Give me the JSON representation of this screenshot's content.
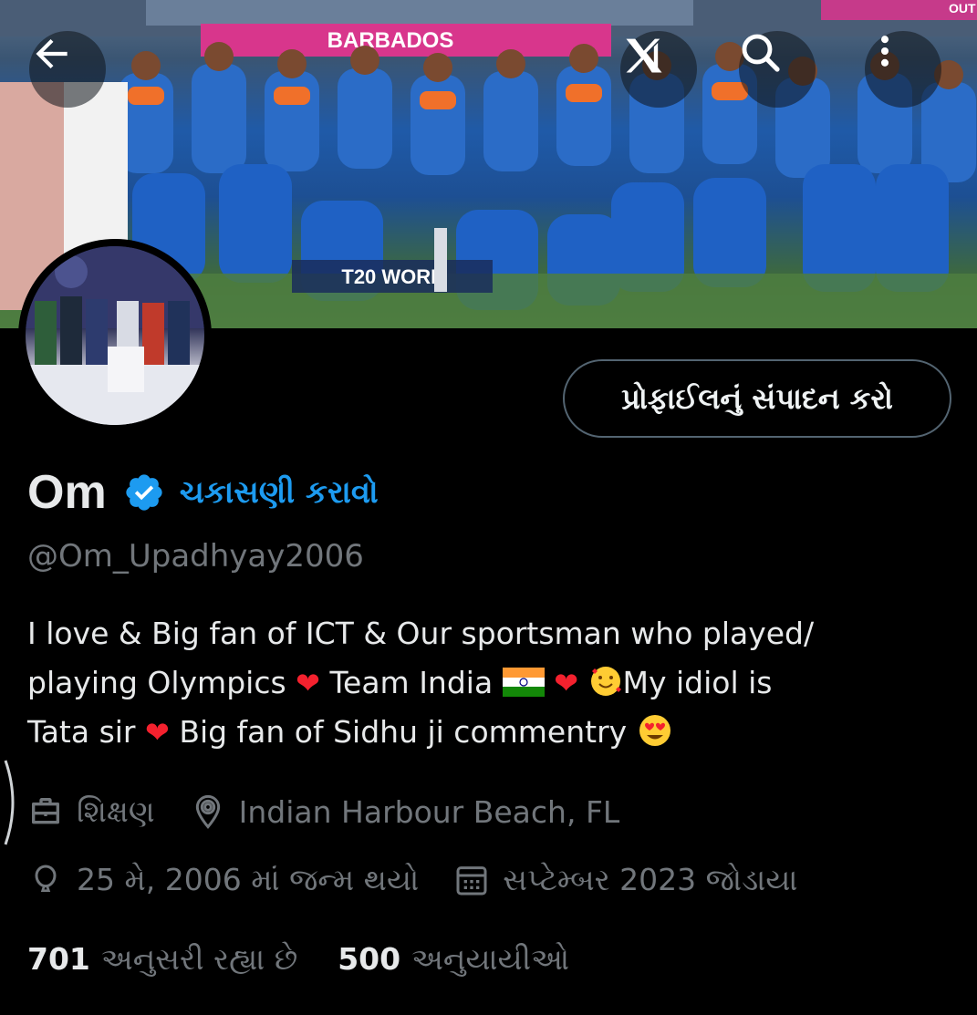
{
  "header": {
    "back_icon": "arrow-left-icon",
    "grok_icon": "grok-icon",
    "search_icon": "search-icon",
    "more_icon": "more-vertical-icon"
  },
  "banner": {
    "signs": [
      "BARBADOS",
      "T20 WORL",
      "OUT"
    ]
  },
  "profile": {
    "edit_button": "પ્રોફાઈલનું સંપાદન કરો",
    "name": "Om",
    "verify_link": "ચકાસણી કરાવો",
    "handle": "@Om_Upadhyay2006",
    "bio": {
      "line1": "I love & Big fan of ICT & Our sportsman who played/",
      "line2a": "playing Olympics",
      "line2b": "Team India",
      "line2c": "My idiol is",
      "line3a": "Tata sir",
      "line3b": "Big fan of Sidhu ji commentry"
    },
    "profession": "શિક્ષણ",
    "location": "Indian Harbour Beach, FL",
    "birthday": "25 મે, 2006 માં જન્મ થયો",
    "joined": "સપ્ટેમ્બર 2023 જોડાયા"
  },
  "stats": {
    "following_count": "701",
    "following_label": "અનુસરી રહ્યા છે",
    "followers_count": "500",
    "followers_label": "અનુયાયીઓ"
  },
  "colors": {
    "background": "#000000",
    "accent": "#1d9bf0",
    "muted": "#71767b",
    "text": "#e7e9ea",
    "border": "#536471"
  }
}
